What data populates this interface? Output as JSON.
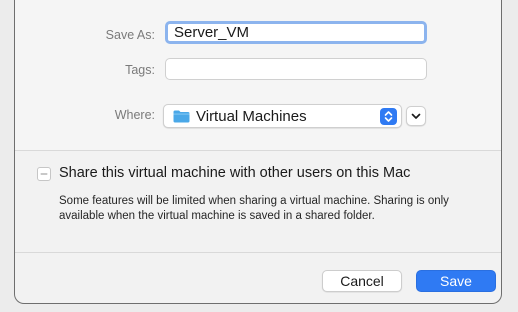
{
  "save_dialog": {
    "save_as_label": "Save As:",
    "save_as_value": "Server_VM",
    "tags_label": "Tags:",
    "tags_value": "",
    "where_label": "Where:",
    "where_value": "Virtual Machines",
    "folder_icon": "folder-icon",
    "stepper_icon": "up-down-chevron-icon",
    "expand_icon": "chevron-down-icon"
  },
  "sharing": {
    "checkbox_label": "Share this virtual machine with other users on this Mac",
    "checked": false,
    "note": "Some features will be limited when sharing a virtual machine. Sharing is only available when the virtual machine is saved in a shared folder."
  },
  "buttons": {
    "cancel_label": "Cancel",
    "save_label": "Save"
  },
  "colors": {
    "accent": "#2f7af3",
    "focus_ring": "#8cb4ee",
    "folder": "#4aa8e8"
  }
}
